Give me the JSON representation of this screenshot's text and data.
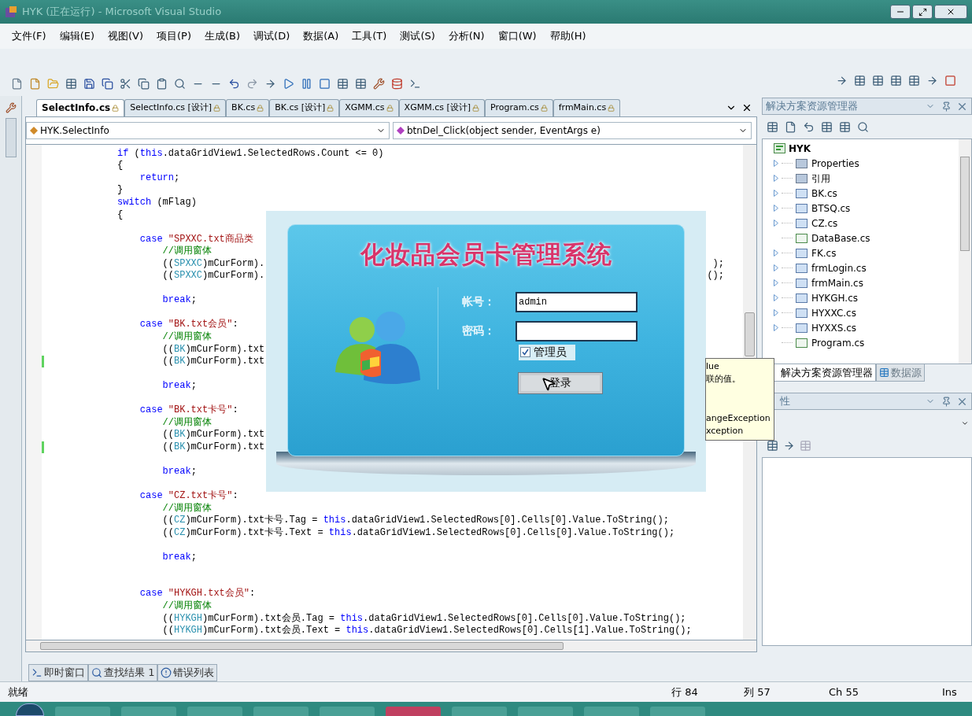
{
  "window": {
    "title": "HYK (正在运行) - Microsoft Visual Studio"
  },
  "menu": [
    "文件(F)",
    "编辑(E)",
    "视图(V)",
    "项目(P)",
    "生成(B)",
    "调试(D)",
    "数据(A)",
    "工具(T)",
    "测试(S)",
    "分析(N)",
    "窗口(W)",
    "帮助(H)"
  ],
  "doc_tabs": [
    {
      "label": "SelectInfo.cs",
      "selected": true
    },
    {
      "label": "SelectInfo.cs [设计]",
      "selected": false
    },
    {
      "label": "BK.cs",
      "selected": false
    },
    {
      "label": "BK.cs [设计]",
      "selected": false
    },
    {
      "label": "XGMM.cs",
      "selected": false
    },
    {
      "label": "XGMM.cs [设计]",
      "selected": false
    },
    {
      "label": "Program.cs",
      "selected": false
    },
    {
      "label": "frmMain.cs",
      "selected": false
    }
  ],
  "class_dropdown": "HYK.SelectInfo",
  "member_dropdown": "btnDel_Click(object sender, EventArgs e)",
  "code_lines": [
    {
      "changed": false,
      "segments": [
        {
          "kind": "keyword",
          "text": "if"
        },
        {
          "kind": "plain",
          "text": " ("
        },
        {
          "kind": "keyword",
          "text": "this"
        },
        {
          "kind": "plain",
          "text": ".dataGridView1.SelectedRows.Count <= 0)"
        }
      ]
    },
    {
      "changed": false,
      "segments": [
        {
          "kind": "plain",
          "text": "{"
        }
      ]
    },
    {
      "changed": false,
      "segments": [
        {
          "kind": "keyword",
          "text": "    return"
        },
        {
          "kind": "plain",
          "text": ";"
        }
      ]
    },
    {
      "changed": false,
      "segments": [
        {
          "kind": "plain",
          "text": "}"
        }
      ]
    },
    {
      "changed": false,
      "segments": [
        {
          "kind": "keyword",
          "text": "switch"
        },
        {
          "kind": "plain",
          "text": " (mFlag)"
        }
      ]
    },
    {
      "changed": false,
      "segments": [
        {
          "kind": "plain",
          "text": "{"
        }
      ]
    },
    {
      "changed": false
    },
    {
      "changed": false,
      "segments": [
        {
          "kind": "keyword",
          "text": "    case"
        },
        {
          "kind": "string",
          "text": " \"SPXXC.txt商品类"
        }
      ]
    },
    {
      "changed": false,
      "segments": [
        {
          "kind": "comment",
          "text": "        //调用窗体"
        }
      ]
    },
    {
      "changed": false,
      "segments": [
        {
          "kind": "plain",
          "text": "        (("
        },
        {
          "kind": "type",
          "text": "SPXXC"
        },
        {
          "kind": "plain",
          "text": ")mCurForm)."
        }
      ],
      "tail": ");"
    },
    {
      "changed": false,
      "segments": [
        {
          "kind": "plain",
          "text": "        (("
        },
        {
          "kind": "type",
          "text": "SPXXC"
        },
        {
          "kind": "plain",
          "text": ")mCurForm)."
        }
      ],
      "tail": "();"
    },
    {
      "changed": false
    },
    {
      "changed": false,
      "segments": [
        {
          "kind": "keyword",
          "text": "        break"
        },
        {
          "kind": "plain",
          "text": ";"
        }
      ]
    },
    {
      "changed": false
    },
    {
      "changed": false,
      "segments": [
        {
          "kind": "keyword",
          "text": "    case"
        },
        {
          "kind": "string",
          "text": " \"BK.txt会员\""
        },
        {
          "kind": "plain",
          "text": ":"
        }
      ]
    },
    {
      "changed": false,
      "segments": [
        {
          "kind": "comment",
          "text": "        //调用窗体"
        }
      ]
    },
    {
      "changed": false,
      "segments": [
        {
          "kind": "plain",
          "text": "        (("
        },
        {
          "kind": "type",
          "text": "BK"
        },
        {
          "kind": "plain",
          "text": ")mCurForm).txt"
        }
      ]
    },
    {
      "changed": true,
      "segments": [
        {
          "kind": "plain",
          "text": "        (("
        },
        {
          "kind": "type",
          "text": "BK"
        },
        {
          "kind": "plain",
          "text": ")mCurForm).txt"
        }
      ]
    },
    {
      "changed": false
    },
    {
      "changed": false,
      "segments": [
        {
          "kind": "keyword",
          "text": "        break"
        },
        {
          "kind": "plain",
          "text": ";"
        }
      ]
    },
    {
      "changed": false
    },
    {
      "changed": false,
      "segments": [
        {
          "kind": "keyword",
          "text": "    case"
        },
        {
          "kind": "string",
          "text": " \"BK.txt卡号\""
        },
        {
          "kind": "plain",
          "text": ":"
        }
      ]
    },
    {
      "changed": false,
      "segments": [
        {
          "kind": "comment",
          "text": "        //调用窗体"
        }
      ]
    },
    {
      "changed": false,
      "segments": [
        {
          "kind": "plain",
          "text": "        (("
        },
        {
          "kind": "type",
          "text": "BK"
        },
        {
          "kind": "plain",
          "text": ")mCurForm).txt"
        }
      ]
    },
    {
      "changed": true,
      "segments": [
        {
          "kind": "plain",
          "text": "        (("
        },
        {
          "kind": "type",
          "text": "BK"
        },
        {
          "kind": "plain",
          "text": ")mCurForm).txt"
        }
      ]
    },
    {
      "changed": false
    },
    {
      "changed": false,
      "segments": [
        {
          "kind": "keyword",
          "text": "        break"
        },
        {
          "kind": "plain",
          "text": ";"
        }
      ]
    },
    {
      "changed": false
    },
    {
      "changed": false,
      "segments": [
        {
          "kind": "keyword",
          "text": "    case"
        },
        {
          "kind": "string",
          "text": " \"CZ.txt卡号\""
        },
        {
          "kind": "plain",
          "text": ":"
        }
      ]
    },
    {
      "changed": false,
      "segments": [
        {
          "kind": "comment",
          "text": "        //调用窗体"
        }
      ]
    },
    {
      "changed": false,
      "segments": [
        {
          "kind": "plain",
          "text": "        (("
        },
        {
          "kind": "type",
          "text": "CZ"
        },
        {
          "kind": "plain",
          "text": ")mCurForm).txt卡号.Tag = "
        },
        {
          "kind": "keyword",
          "text": "this"
        },
        {
          "kind": "plain",
          "text": ".dataGridView1.SelectedRows[0].Cells[0].Value.ToString();"
        }
      ]
    },
    {
      "changed": false,
      "segments": [
        {
          "kind": "plain",
          "text": "        (("
        },
        {
          "kind": "type",
          "text": "CZ"
        },
        {
          "kind": "plain",
          "text": ")mCurForm).txt卡号.Text = "
        },
        {
          "kind": "keyword",
          "text": "this"
        },
        {
          "kind": "plain",
          "text": ".dataGridView1.SelectedRows[0].Cells[0].Value.ToString();"
        }
      ]
    },
    {
      "changed": false
    },
    {
      "changed": false,
      "segments": [
        {
          "kind": "keyword",
          "text": "        break"
        },
        {
          "kind": "plain",
          "text": ";"
        }
      ]
    },
    {
      "changed": false
    },
    {
      "changed": false
    },
    {
      "changed": false,
      "segments": [
        {
          "kind": "keyword",
          "text": "    case"
        },
        {
          "kind": "string",
          "text": " \"HYKGH.txt会员\""
        },
        {
          "kind": "plain",
          "text": ":"
        }
      ]
    },
    {
      "changed": false,
      "segments": [
        {
          "kind": "comment",
          "text": "        //调用窗体"
        }
      ]
    },
    {
      "changed": false,
      "segments": [
        {
          "kind": "plain",
          "text": "        (("
        },
        {
          "kind": "type",
          "text": "HYKGH"
        },
        {
          "kind": "plain",
          "text": ")mCurForm).txt会员.Tag = "
        },
        {
          "kind": "keyword",
          "text": "this"
        },
        {
          "kind": "plain",
          "text": ".dataGridView1.SelectedRows[0].Cells[0].Value.ToString();"
        }
      ]
    },
    {
      "changed": false,
      "segments": [
        {
          "kind": "plain",
          "text": "        (("
        },
        {
          "kind": "type",
          "text": "HYKGH"
        },
        {
          "kind": "plain",
          "text": ")mCurForm).txt会员.Text = "
        },
        {
          "kind": "keyword",
          "text": "this"
        },
        {
          "kind": "plain",
          "text": ".dataGridView1.SelectedRows[0].Cells[1].Value.ToString();"
        }
      ]
    }
  ],
  "login_dialog": {
    "title": "化妆品会员卡管理系统",
    "account_label": "帐号：",
    "account_value": "admin",
    "password_label": "密码：",
    "admin_checkbox": {
      "label": "管理员",
      "checked": true
    },
    "login_button": "登录"
  },
  "tooltip": {
    "summary_lines": [
      "lue",
      "联的值。"
    ],
    "exception_lines": [
      "angeException",
      "xception"
    ]
  },
  "solution_explorer": {
    "title": "解决方案资源管理器",
    "root": {
      "label": "HYK",
      "children": [
        {
          "label": "Properties",
          "kind": "properties",
          "expandable": true
        },
        {
          "label": "引用",
          "kind": "references",
          "expandable": true
        },
        {
          "label": "BK.cs",
          "kind": "form",
          "expandable": true
        },
        {
          "label": "BTSQ.cs",
          "kind": "form",
          "expandable": true
        },
        {
          "label": "CZ.cs",
          "kind": "form",
          "expandable": true
        },
        {
          "label": "DataBase.cs",
          "kind": "code",
          "expandable": false
        },
        {
          "label": "FK.cs",
          "kind": "form",
          "expandable": true
        },
        {
          "label": "frmLogin.cs",
          "kind": "form",
          "expandable": true
        },
        {
          "label": "frmMain.cs",
          "kind": "form",
          "expandable": true
        },
        {
          "label": "HYKGH.cs",
          "kind": "form",
          "expandable": true
        },
        {
          "label": "HYXXC.cs",
          "kind": "form",
          "expandable": true
        },
        {
          "label": "HYXXS.cs",
          "kind": "form",
          "expandable": true
        },
        {
          "label": "Program.cs",
          "kind": "code",
          "expandable": false
        }
      ]
    }
  },
  "panel_tabs": [
    {
      "label": "解决方案资源管理器",
      "selected": true
    },
    {
      "label": "数据源",
      "selected": false
    }
  ],
  "properties_panel": {
    "title": "性"
  },
  "bottom_tabs": [
    "即时窗口",
    "查找结果 1",
    "错误列表"
  ],
  "status_bar": {
    "message": "就绪",
    "line": "行 84",
    "column": "列 57",
    "char": "Ch 55",
    "mode": "Ins"
  }
}
